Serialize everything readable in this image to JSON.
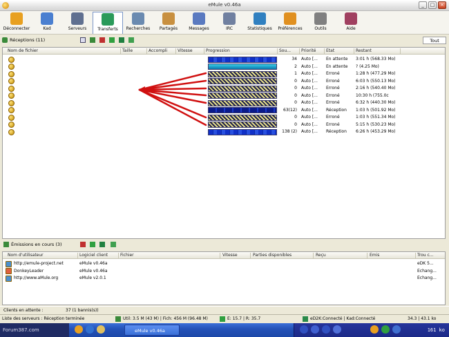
{
  "window": {
    "title": "eMule v0.46a"
  },
  "toolbar": {
    "items": [
      {
        "label": "Déconnecter",
        "icon": "disconnect-icon",
        "color": "#e8a020"
      },
      {
        "label": "Kad",
        "icon": "kad-icon",
        "color": "#4a7fd0"
      },
      {
        "label": "Serveurs",
        "icon": "servers-icon",
        "color": "#607090"
      },
      {
        "label": "Transferts",
        "icon": "transfers-icon",
        "color": "#2a9a5a"
      },
      {
        "label": "Recherches",
        "icon": "search-icon",
        "color": "#6a8ab0"
      },
      {
        "label": "Partagés",
        "icon": "shared-files-icon",
        "color": "#c89040"
      },
      {
        "label": "Messages",
        "icon": "messages-icon",
        "color": "#5a7ac0"
      },
      {
        "label": "IRC",
        "icon": "irc-icon",
        "color": "#7080a0"
      },
      {
        "label": "Statistiques",
        "icon": "statistics-icon",
        "color": "#3080c0"
      },
      {
        "label": "Préférences",
        "icon": "preferences-gear-icon",
        "color": "#e09020"
      },
      {
        "label": "Outils",
        "icon": "tools-icon",
        "color": "#808080"
      },
      {
        "label": "Aide",
        "icon": "help-icon",
        "color": "#a04060"
      }
    ]
  },
  "downloads": {
    "section_title": "Réceptions (11)",
    "tab_label": "Tout",
    "columns": [
      "Nom de fichier",
      "Taille",
      "Accompli",
      "Vitesse",
      "Progression",
      "Sou...",
      "Priorité",
      "État",
      "Restant"
    ],
    "rows": [
      {
        "sources": "34",
        "priority": "Auto [...",
        "state": "En attente",
        "remaining": "3:01 h (568.33 Mo)",
        "bar": "blue"
      },
      {
        "sources": "2",
        "priority": "Auto [...",
        "state": "En attente",
        "remaining": "? (4.25 Mo)",
        "bar": "cyan"
      },
      {
        "sources": "1",
        "priority": "Auto [...",
        "state": "Erroné",
        "remaining": "1:28 h (477.29 Mo)",
        "bar": "hatch"
      },
      {
        "sources": "0",
        "priority": "Auto [...",
        "state": "Erroné",
        "remaining": "6:03 h (550.13 Mo)",
        "bar": "hatch"
      },
      {
        "sources": "0",
        "priority": "Auto [...",
        "state": "Erroné",
        "remaining": "2:16 h (540.40 Mo)",
        "bar": "hatch"
      },
      {
        "sources": "0",
        "priority": "Auto [...",
        "state": "Erroné",
        "remaining": "10:30 h (755.0c",
        "bar": "hatch"
      },
      {
        "sources": "0",
        "priority": "Auto [...",
        "state": "Erroné",
        "remaining": "6:32 h (440.30 Mo)",
        "bar": "hatch"
      },
      {
        "sources": "63(12)",
        "priority": "Auto [...",
        "state": "Réception",
        "remaining": "1:03 h (501.92 Mo)",
        "bar": "darkblue"
      },
      {
        "sources": "0",
        "priority": "Auto [...",
        "state": "Erroné",
        "remaining": "1:03 h (551.34 Mo)",
        "bar": "hatch"
      },
      {
        "sources": "0",
        "priority": "Auto [...",
        "state": "Erroné",
        "remaining": "5:15 h (530.23 Mo)",
        "bar": "hatch"
      },
      {
        "sources": "138 (2)",
        "priority": "Auto [...",
        "state": "Réception",
        "remaining": "6:26 h (453.29 Mo)",
        "bar": "blue"
      }
    ]
  },
  "uploads": {
    "section_title": "Émissions en cours (3)",
    "columns": [
      "Nom d'utilisateur",
      "Logiciel client",
      "Fichier",
      "Vitesse",
      "Parties disponibles",
      "Reçu",
      "Émis",
      "Trou c..."
    ],
    "rows": [
      {
        "user": "http://emule-project.net",
        "client": "eMule v0.46a",
        "status": "eDK 5..."
      },
      {
        "user": "DonkeyLeader",
        "client": "eMule v0.46a",
        "status": "Échang..."
      },
      {
        "user": "http://www.aMule.org",
        "client": "eMule v2.0.1",
        "status": "Échang..."
      }
    ]
  },
  "status": {
    "clients_label": "Clients en attente :",
    "clients_value": "37 (1 bannis(s))",
    "info_left": "Liste des serveurs : Réception terminée",
    "info_users": "Util: 3.5 M (43 M) | Fich: 456 M (96.48 M)",
    "info_speed": "E: 15.7 | R: 35.7",
    "info_server": "eD2K:Connecté | Kad:Connecté",
    "info_rate": "34.3 | 43.1 ko"
  },
  "taskbar": {
    "start_label": "Forum387.com",
    "task_label": "eMule v0.46a",
    "clock": "161 ko"
  }
}
